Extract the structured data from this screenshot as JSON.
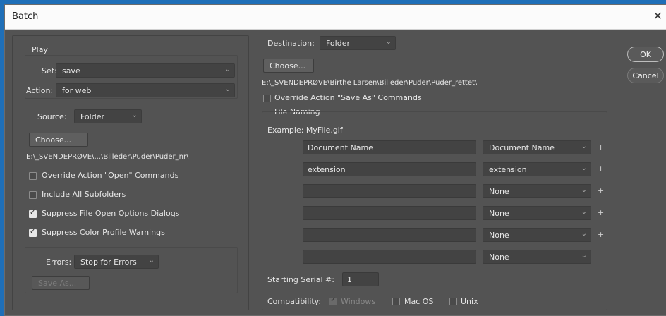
{
  "window": {
    "title": "Batch",
    "close_glyph": "✕"
  },
  "play": {
    "group_label": "Play",
    "set_label": "Set:",
    "set_value": "save",
    "action_label": "Action:",
    "action_value": "for web"
  },
  "source": {
    "label": "Source:",
    "value": "Folder",
    "choose_label": "Choose...",
    "path": "E:\\_SVENDEPRØVE\\...\\Billeder\\Puder\\Puder_nr\\",
    "options": [
      {
        "label": "Override Action \"Open\" Commands",
        "checked": false
      },
      {
        "label": "Include All Subfolders",
        "checked": false
      },
      {
        "label": "Suppress File Open Options Dialogs",
        "checked": true
      },
      {
        "label": "Suppress Color Profile Warnings",
        "checked": true
      }
    ]
  },
  "errors": {
    "label": "Errors:",
    "value": "Stop for Errors",
    "save_as_label": "Save As..."
  },
  "destination": {
    "label": "Destination:",
    "value": "Folder",
    "choose_label": "Choose...",
    "path": "E:\\_SVENDEPRØVE\\Birthe Larsen\\Billeder\\Puder\\Puder_rettet\\",
    "override_label": "Override Action \"Save As\" Commands",
    "override_checked": false
  },
  "file_naming": {
    "group_label": "File Naming",
    "example": "Example: MyFile.gif",
    "rows": [
      {
        "text": "Document Name",
        "select": "Document Name",
        "plus": "+"
      },
      {
        "text": "extension",
        "select": "extension",
        "plus": "+"
      },
      {
        "text": "",
        "select": "None",
        "plus": "+"
      },
      {
        "text": "",
        "select": "None",
        "plus": "+"
      },
      {
        "text": "",
        "select": "None",
        "plus": "+"
      },
      {
        "text": "",
        "select": "None",
        "plus": ""
      }
    ],
    "serial_label": "Starting Serial #:",
    "serial_value": "1",
    "compat_label": "Compatibility:",
    "compat": [
      {
        "label": "Windows",
        "checked": true,
        "disabled": true
      },
      {
        "label": "Mac OS",
        "checked": false,
        "disabled": false
      },
      {
        "label": "Unix",
        "checked": false,
        "disabled": false
      }
    ]
  },
  "buttons": {
    "ok": "OK",
    "cancel": "Cancel"
  }
}
